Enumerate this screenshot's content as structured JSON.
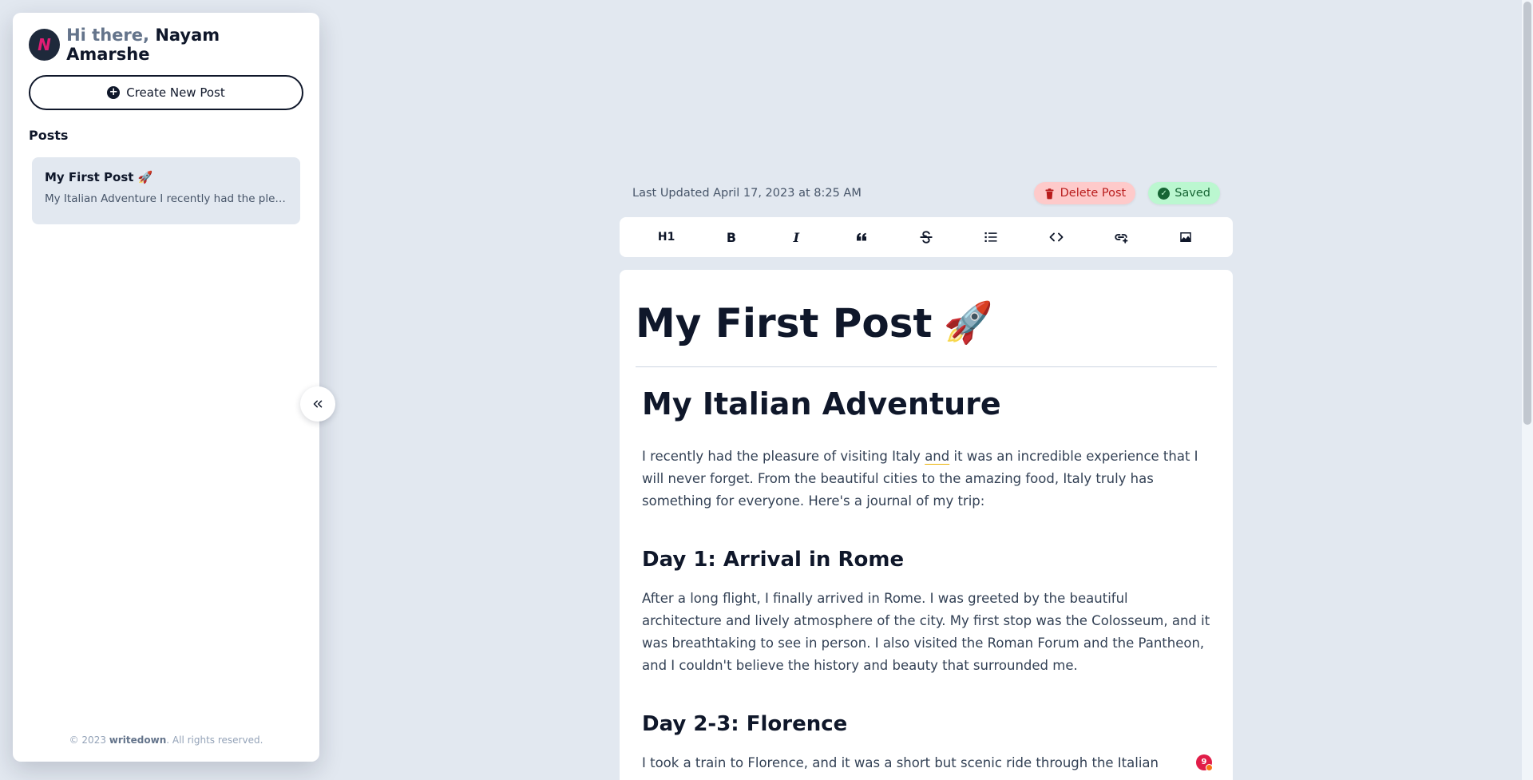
{
  "sidebar": {
    "logo_letter": "N",
    "greeting_prefix": "Hi there,",
    "user_name": "Nayam Amarshe",
    "create_label": "Create New Post",
    "posts_heading": "Posts",
    "posts": [
      {
        "title": "My First Post 🚀",
        "excerpt": "My Italian Adventure I recently had the pleasure of visiting Italy and it was an incredible experience"
      }
    ],
    "footer_prefix": "© 2023",
    "footer_brand": "writedown",
    "footer_suffix": ". All rights reserved."
  },
  "editor": {
    "last_updated": "Last Updated April 17, 2023 at 8:25 AM",
    "delete_label": "Delete Post",
    "saved_label": "Saved",
    "toolbar": {
      "h1": "H1",
      "bold": "B",
      "italic": "I"
    },
    "title": "My First Post",
    "title_emoji": "🚀",
    "content": {
      "heading": "My Italian Adventure",
      "intro_a": "I recently had the pleasure of visiting Italy ",
      "intro_underlined": "and",
      "intro_b": " it was an incredible experience that I will never forget. From the beautiful cities to the amazing food, Italy truly has something for everyone. Here's a journal of my trip:",
      "day1_heading": "Day 1: Arrival in Rome",
      "day1_text": "After a long flight, I finally arrived in Rome. I was greeted by the beautiful architecture and lively atmosphere of the city. My first stop was the Colosseum, and it was breathtaking to see in person. I also visited the Roman Forum and the Pantheon, and I couldn't believe the history and beauty that surrounded me.",
      "day2_heading": "Day 2-3: Florence",
      "day2_text": "I took a train to Florence, and it was a short but scenic ride through the Italian"
    },
    "notification_count": "9"
  },
  "colors": {
    "background": "#e2e8f0",
    "delete_bg": "#fecaca",
    "saved_bg": "#bbf7d0",
    "logo_accent": "#e11d74"
  }
}
